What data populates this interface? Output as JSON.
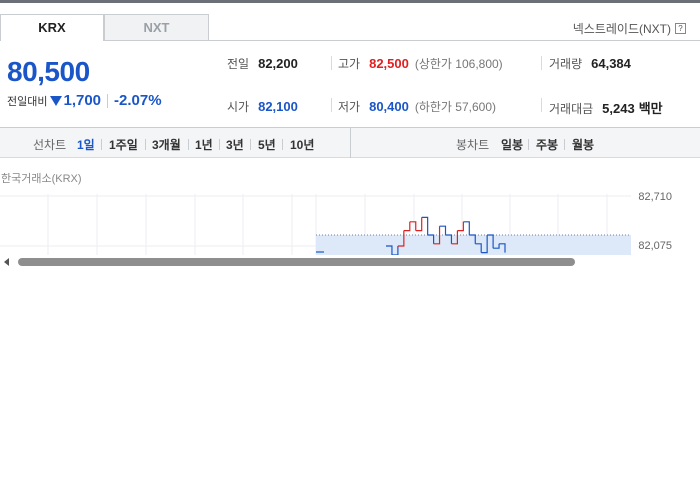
{
  "market_tabs": [
    {
      "label": "KRX",
      "active": true
    },
    {
      "label": "NXT",
      "active": false
    }
  ],
  "nextrade_link": "넥스트레이드(NXT)",
  "help_icon": "?",
  "quote": {
    "price": "80,500",
    "change_label": "전일대비",
    "change_value": "1,700",
    "change_direction": "down",
    "change_rate": "-2.07%"
  },
  "stats": {
    "prev_close": {
      "label": "전일",
      "value": "82,200"
    },
    "open": {
      "label": "시가",
      "value": "82,100"
    },
    "high": {
      "label": "고가",
      "value": "82,500",
      "sub": "(상한가 106,800)"
    },
    "low": {
      "label": "저가",
      "value": "80,400",
      "sub": "(하한가 57,600)"
    },
    "volume": {
      "label": "거래량",
      "value": "64,384"
    },
    "amount": {
      "label": "거래대금",
      "value": "5,243",
      "unit": "백만"
    }
  },
  "line_chart_label": "선차트",
  "periods": [
    "1일",
    "1주일",
    "3개월",
    "1년",
    "3년",
    "5년",
    "10년"
  ],
  "active_period": "1일",
  "candle_chart_label": "봉차트",
  "candle_periods": [
    "일봉",
    "주봉",
    "월봉"
  ],
  "chart_source": "한국거래소(KRX)",
  "chart_data": {
    "type": "line",
    "y_ticks": [
      "82,710",
      "82,075"
    ],
    "ylim": [
      81600,
      82710
    ],
    "reference_value": 82200,
    "series": [
      {
        "values": [
          82075,
          81950,
          82075,
          82250,
          82350,
          82250,
          82400,
          82200,
          82100,
          82300,
          82200,
          82100,
          82250,
          82350,
          82200,
          82100,
          82000,
          82200,
          82050,
          82100,
          82000
        ]
      }
    ],
    "colors": {
      "up": "#e02020",
      "down": "#1a56c8",
      "fill": "#dde9f8"
    }
  },
  "colors": {
    "up": "#e02020",
    "down": "#1a56c8",
    "accent_bar": "#6b6f76"
  }
}
